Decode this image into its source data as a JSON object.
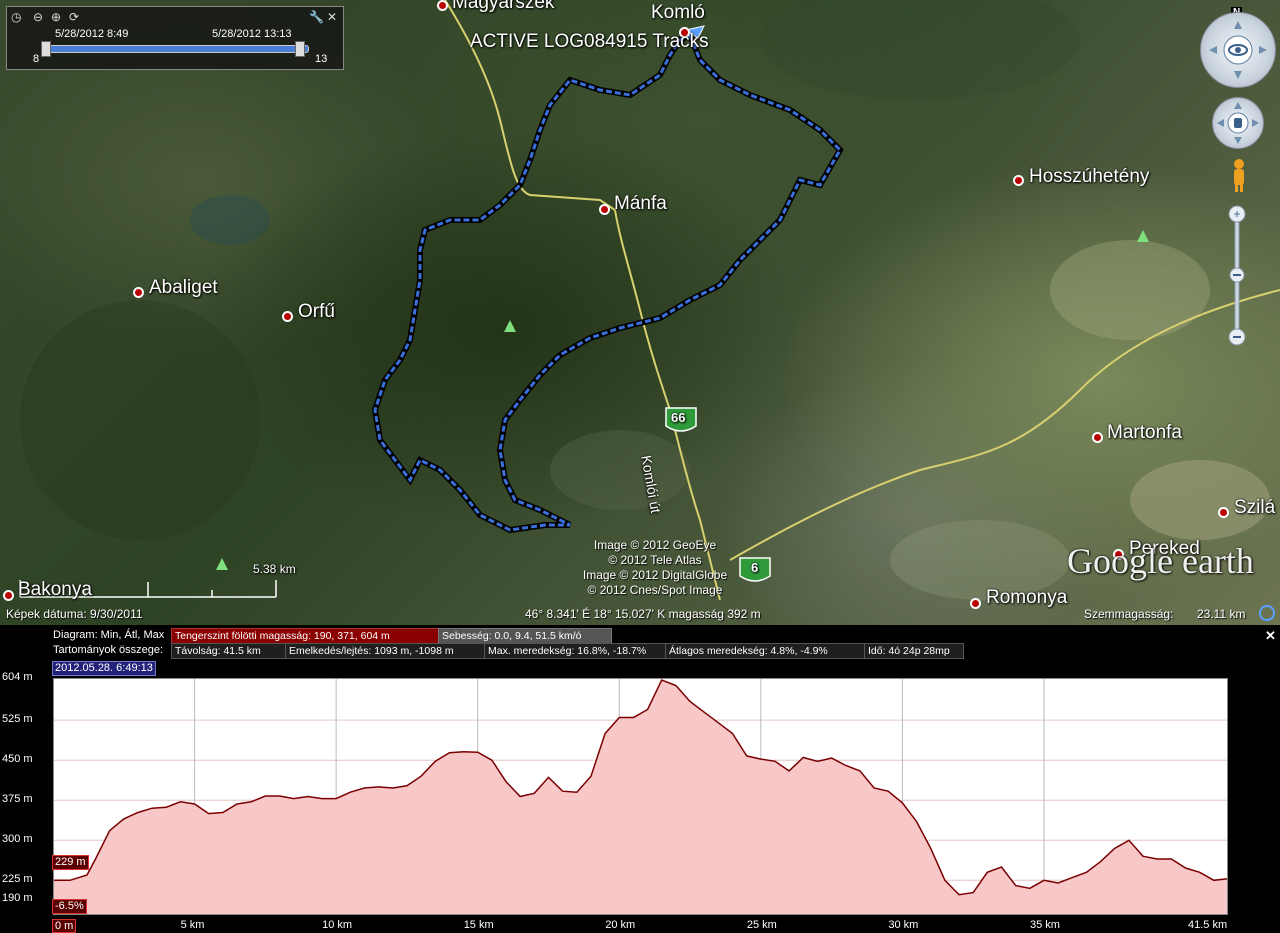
{
  "time_slider": {
    "start_time": "5/28/2012  8:49",
    "end_time": "5/28/2012  13:13",
    "start_tick": "8",
    "end_tick": "13",
    "icons": [
      "clock-icon",
      "zoom-out-icon",
      "zoom-in-icon",
      "play-icon",
      "wrench-icon",
      "close-icon"
    ]
  },
  "map": {
    "track_label": "ACTIVE LOG084915   Tracks",
    "places": [
      "Magyarszék",
      "Komló",
      "Mánfa",
      "Hosszúhetény",
      "Abaliget",
      "Orfű",
      "Martonfa",
      "Pereked",
      "Szilá",
      "Romonya",
      "Bakonya"
    ],
    "road_66": "66",
    "road_6": "6",
    "road_name": "Komlói út",
    "scale_label": "5.38 km",
    "copyright": [
      "Image © 2012 GeoEye",
      "© 2012 Tele Atlas",
      "Image © 2012 DigitalGlobe",
      "© 2012 Cnes/Spot Image"
    ],
    "logo": "Google earth",
    "compass_n": "N",
    "track_color": "#3b6fd9"
  },
  "status": {
    "imagery_date": "Képek dátuma: 9/30/2011",
    "coordinates": "46° 8.341' É   18° 15.027' K magasság   392 m",
    "eye_alt_label": "Szemmagasság:",
    "eye_alt_value": "23.11 km"
  },
  "profile": {
    "row1_label": "Diagram: Min, Átl, Max",
    "row1_elev": "Tengerszint fölötti magasság: 190, 371, 604 m",
    "row1_speed": "Sebesség: 0.0, 9.4, 51.5 km/ó",
    "row2_label": "Tartományok összege:",
    "row2_cells": [
      "Távolság: 41.5 km",
      "Emelkedés/lejtés: 1093 m, -1098 m",
      "Max. meredekség: 16.8%, -18.7%",
      "Átlagos meredekség: 4.8%, -4.9%",
      "Idő: 4ó 24p 28mp"
    ],
    "date_box": "2012.05.28. 6:49:13",
    "current_elev": "229 m",
    "current_slope": "-6.5%",
    "close_icon": "close-icon"
  },
  "chart_data": {
    "type": "area",
    "xlabel": "",
    "ylabel": "",
    "x_unit": "km",
    "x_ticks": [
      "0 m",
      "5 km",
      "10 km",
      "15 km",
      "20 km",
      "25 km",
      "30 km",
      "35 km",
      "41.5 km"
    ],
    "x_tick_values": [
      0,
      5,
      10,
      15,
      20,
      25,
      30,
      35,
      41.5
    ],
    "y_ticks": [
      "604 m",
      "525 m",
      "450 m",
      "375 m",
      "300 m",
      "225 m",
      "190 m"
    ],
    "y_tick_values": [
      604,
      525,
      450,
      375,
      300,
      225,
      190
    ],
    "xlim": [
      0,
      41.5
    ],
    "ylim": [
      160,
      604
    ],
    "grid": true,
    "fill_color": "#f8c8c8",
    "line_color": "#7a0000",
    "series": [
      {
        "x": [
          0,
          0.6,
          1.2,
          1.5,
          2,
          2.5,
          3,
          3.5,
          4,
          4.5,
          5,
          5.5,
          6,
          6.5,
          7,
          7.5,
          8,
          8.5,
          9,
          9.5,
          10,
          10.5,
          11,
          11.5,
          12,
          12.5,
          13,
          13.5,
          14,
          14.5,
          15,
          15.5,
          16,
          16.5,
          17,
          17.5,
          18,
          18.5,
          19,
          19.5,
          20,
          20.5,
          21,
          21.5,
          22,
          22.5,
          23,
          23.5,
          24,
          24.5,
          25,
          25.5,
          26,
          26.5,
          27,
          27.5,
          28,
          28.5,
          29,
          29.5,
          30,
          30.5,
          31,
          31.5,
          32,
          32.5,
          33,
          33.5,
          34,
          34.5,
          35,
          35.5,
          36,
          36.5,
          37,
          37.5,
          38,
          38.5,
          39,
          39.5,
          40,
          40.5,
          41,
          41.5
        ],
        "values": [
          225,
          225,
          235,
          265,
          318,
          340,
          352,
          360,
          362,
          372,
          368,
          350,
          352,
          368,
          372,
          383,
          383,
          378,
          382,
          378,
          378,
          390,
          398,
          400,
          398,
          402,
          420,
          448,
          464,
          466,
          465,
          450,
          410,
          382,
          388,
          418,
          392,
          390,
          420,
          500,
          530,
          530,
          545,
          600,
          590,
          560,
          540,
          520,
          500,
          458,
          452,
          448,
          430,
          455,
          448,
          454,
          440,
          430,
          398,
          392,
          370,
          335,
          285,
          225,
          198,
          202,
          240,
          250,
          215,
          210,
          225,
          220,
          230,
          240,
          260,
          285,
          300,
          270,
          265,
          265,
          248,
          240,
          225,
          228
        ]
      }
    ]
  }
}
